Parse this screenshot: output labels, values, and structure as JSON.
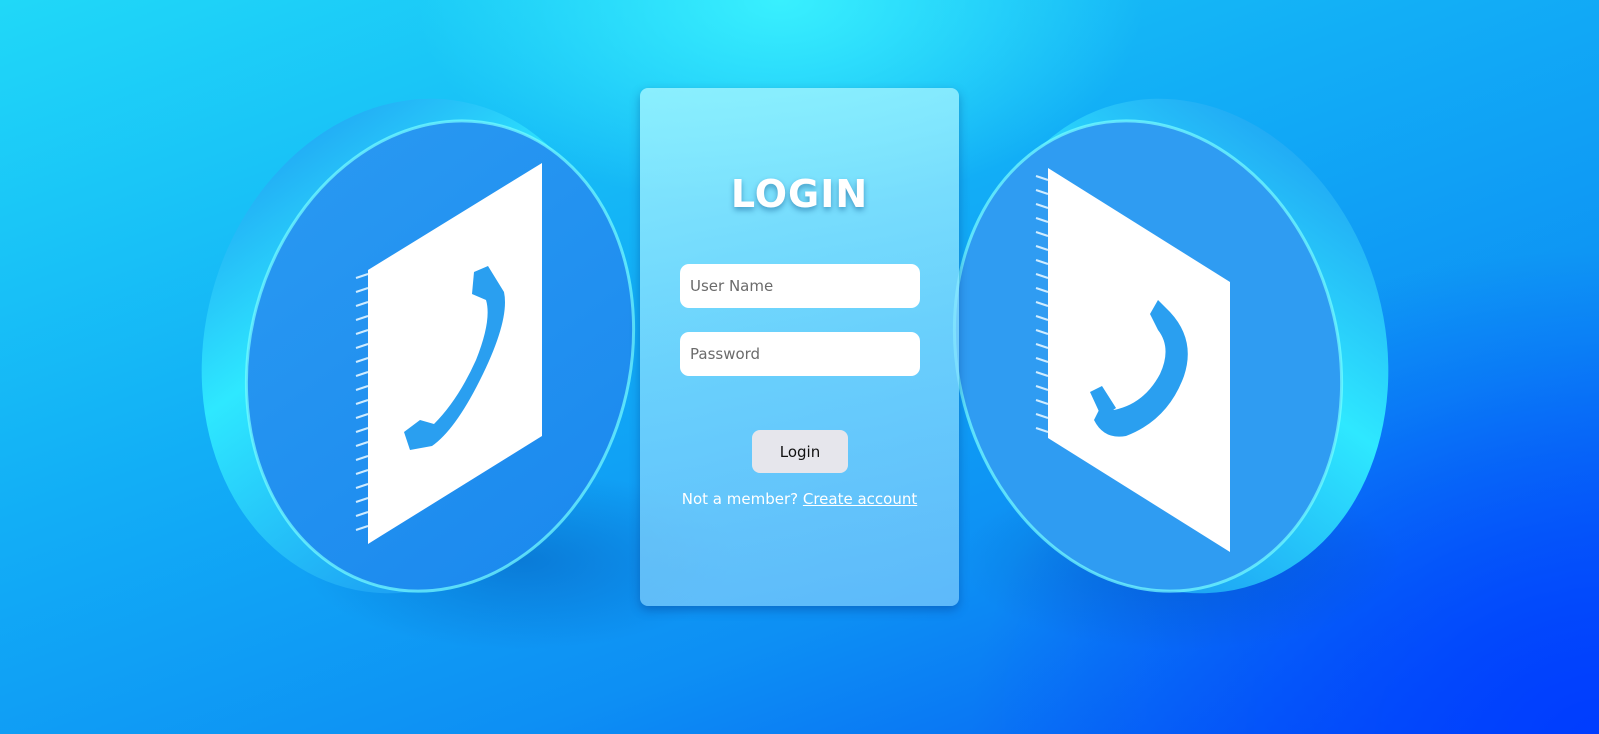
{
  "login_card": {
    "title": "LOGIN",
    "username_placeholder": "User Name",
    "password_placeholder": "Password",
    "login_button_label": "Login",
    "not_member_text": "Not a member?",
    "create_account_link": "Create account"
  },
  "decoration": {
    "left_icon": "phone-book-icon",
    "right_icon": "phone-book-icon"
  },
  "colors": {
    "background_top": "#3cf5ff",
    "background_bottom_right": "#0555f5",
    "disc_blue": "#1a9cf0",
    "button_bg": "#e6e6ec",
    "text_white": "#ffffff"
  }
}
